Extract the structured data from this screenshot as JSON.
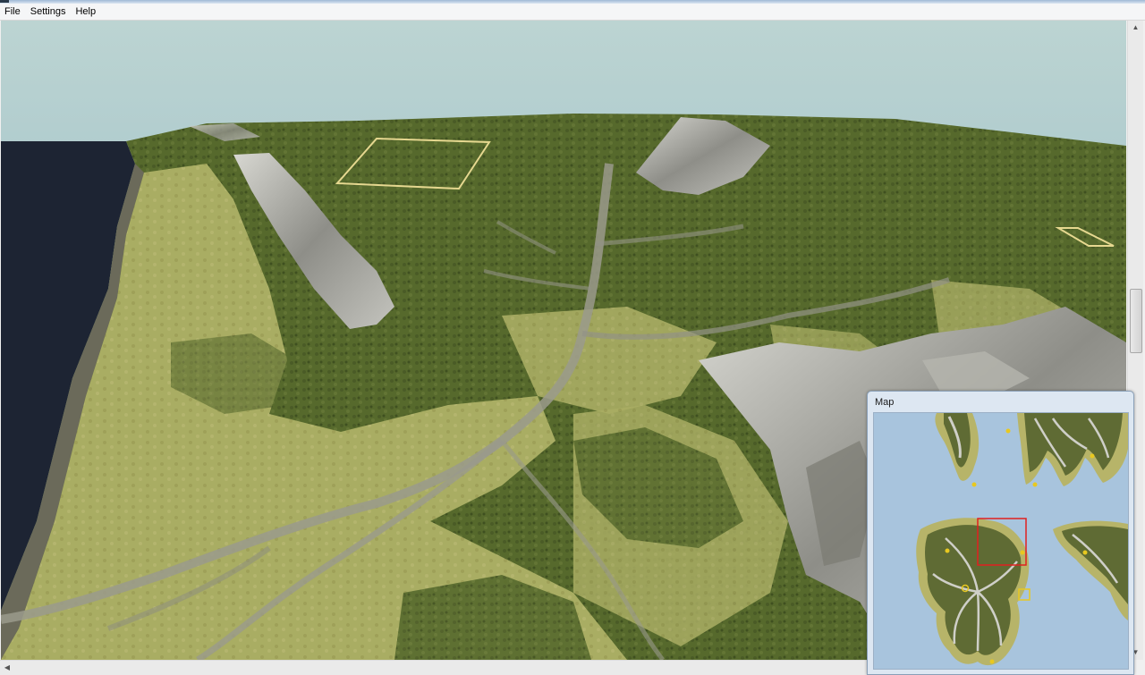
{
  "menubar": {
    "items": [
      "File",
      "Settings",
      "Help"
    ]
  },
  "map_panel": {
    "title": "Map"
  },
  "colors": {
    "sky": "#b9d1d0",
    "water_3d": "#1d2433",
    "forest": "#5a6b2f",
    "grass": "#a8ac62",
    "rock": "#9a9a94",
    "map_water": "#a8c4dd",
    "map_viewport_box": "#e02020",
    "map_marker": "#e8c820"
  },
  "status": {
    "text": ""
  }
}
